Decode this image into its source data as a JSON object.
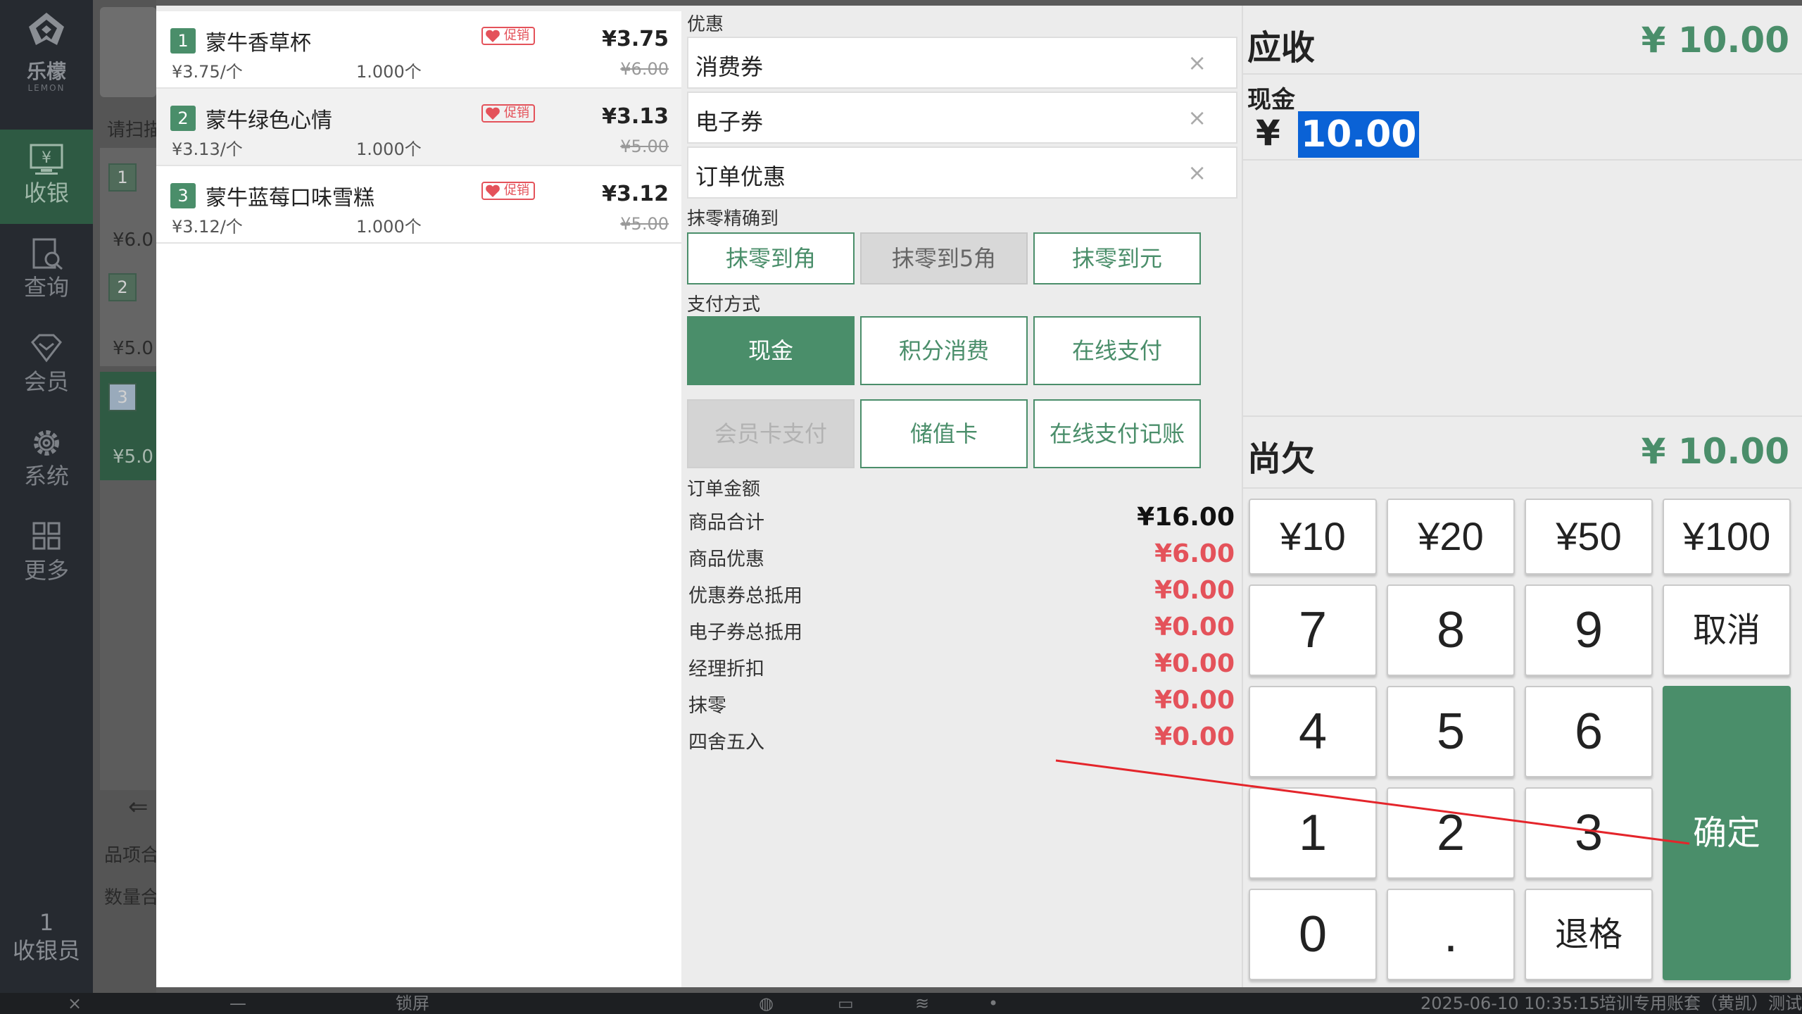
{
  "brand": {
    "name_cn": "乐檬",
    "name_en": "LEMON"
  },
  "sidebar": {
    "items": [
      {
        "label": "收银",
        "icon": "cashier-icon"
      },
      {
        "label": "查询",
        "icon": "query-icon"
      },
      {
        "label": "会员",
        "icon": "member-icon"
      },
      {
        "label": "系统",
        "icon": "gear-icon"
      },
      {
        "label": "更多",
        "icon": "grid-icon"
      }
    ],
    "cashier_count": "1",
    "cashier_label": "收银员"
  },
  "background_cart": {
    "scan_hint": "请扫描",
    "rows": [
      {
        "index": "1",
        "price": "¥6.0"
      },
      {
        "index": "2",
        "price": "¥5.0"
      },
      {
        "index": "3",
        "price": "¥5.0"
      }
    ],
    "total_items_label": "品项合",
    "total_qty_label": "数量合"
  },
  "products": [
    {
      "index": "1",
      "name": "蒙牛香草杯",
      "tag": "促销",
      "price": "¥3.75",
      "unit_price": "¥3.75/个",
      "qty": "1.000个",
      "orig_price": "¥6.00"
    },
    {
      "index": "2",
      "name": "蒙牛绿色心情",
      "tag": "促销",
      "price": "¥3.13",
      "unit_price": "¥3.13/个",
      "qty": "1.000个",
      "orig_price": "¥5.00"
    },
    {
      "index": "3",
      "name": "蒙牛蓝莓口味雪糕",
      "tag": "促销",
      "price": "¥3.12",
      "unit_price": "¥3.12/个",
      "qty": "1.000个",
      "orig_price": "¥5.00"
    }
  ],
  "discount": {
    "label": "优惠",
    "items": [
      {
        "label": "消费券",
        "close": "×"
      },
      {
        "label": "电子券",
        "close": "×"
      },
      {
        "label": "订单优惠",
        "close": "×"
      }
    ]
  },
  "rounding": {
    "label": "抹零精确到",
    "options": [
      {
        "label": "抹零到角",
        "selected": false
      },
      {
        "label": "抹零到5角",
        "selected": true
      },
      {
        "label": "抹零到元",
        "selected": false
      }
    ]
  },
  "payment": {
    "label": "支付方式",
    "methods": [
      {
        "label": "现金",
        "state": "active"
      },
      {
        "label": "积分消费",
        "state": "normal"
      },
      {
        "label": "在线支付",
        "state": "normal"
      },
      {
        "label": "会员卡支付",
        "state": "disabled"
      },
      {
        "label": "储值卡",
        "state": "normal"
      },
      {
        "label": "在线支付记账",
        "state": "normal"
      }
    ]
  },
  "order_amount": {
    "label": "订单金额",
    "rows": [
      {
        "key": "商品合计",
        "value": "¥16.00",
        "color": "#111111"
      },
      {
        "key": "商品优惠",
        "value": "¥6.00",
        "color": "#e4525a"
      },
      {
        "key": "优惠券总抵用",
        "value": "¥0.00",
        "color": "#e4525a"
      },
      {
        "key": "电子券总抵用",
        "value": "¥0.00",
        "color": "#e4525a"
      },
      {
        "key": "经理折扣",
        "value": "¥0.00",
        "color": "#e4525a"
      },
      {
        "key": "抹零",
        "value": "¥0.00",
        "color": "#e4525a"
      },
      {
        "key": "四舍五入",
        "value": "¥0.00",
        "color": "#e4525a"
      }
    ]
  },
  "receivable": {
    "label": "应收",
    "value": "¥ 10.00"
  },
  "cash": {
    "label": "现金",
    "currency": "¥",
    "value": "10.00"
  },
  "owed": {
    "label": "尚欠",
    "value": "¥ 10.00"
  },
  "keypad": {
    "money_keys": [
      "¥10",
      "¥20",
      "¥50",
      "¥100"
    ],
    "digits": [
      "7",
      "8",
      "9",
      "4",
      "5",
      "6",
      "1",
      "2",
      "3",
      "0",
      "."
    ],
    "cancel": "取消",
    "backspace": "退格",
    "confirm": "确定"
  },
  "statusbar": {
    "close": "×",
    "minimize": "—",
    "lock": "锁屏",
    "datetime": "2025-06-10 10:35:15",
    "account": "培训专用账套（黄凯）测试"
  },
  "colors": {
    "accent": "#4a8e6a",
    "negative": "#e4525a",
    "sidebar": "#262a30",
    "selection": "#0a62d6"
  }
}
